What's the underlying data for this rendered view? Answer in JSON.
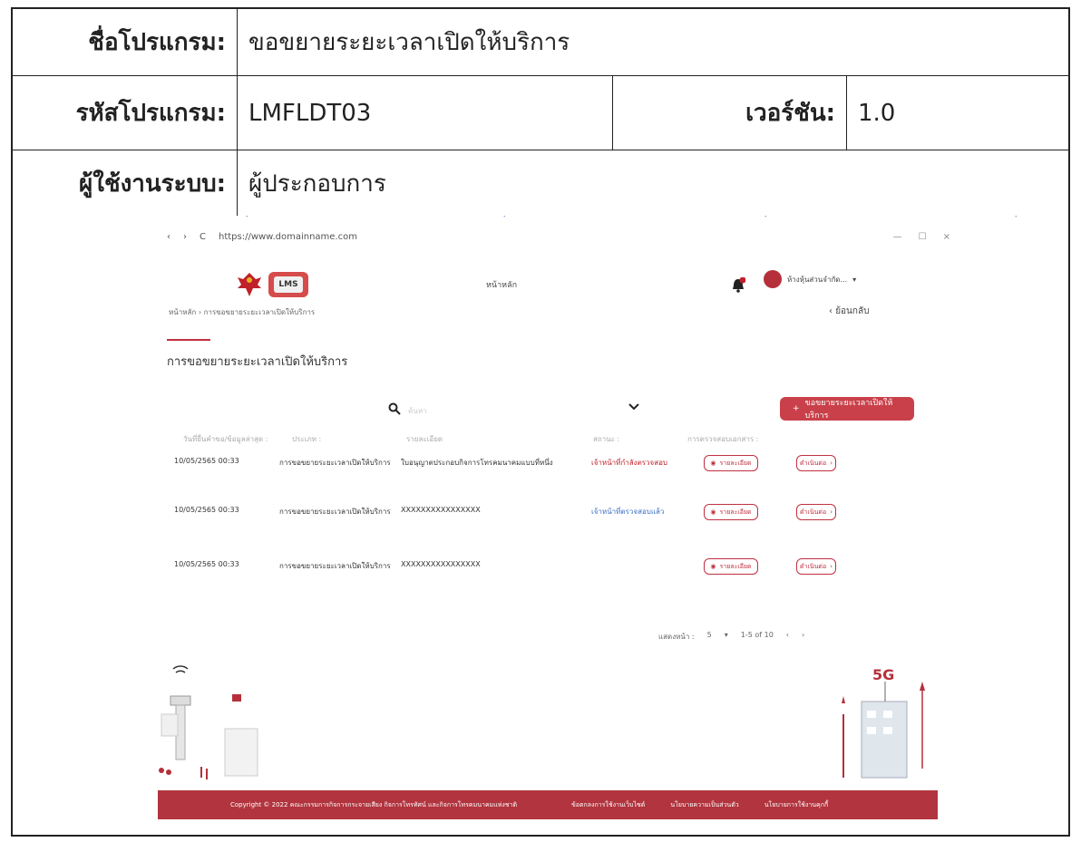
{
  "doc": {
    "program_name_label": "ชื่อโปรแกรม:",
    "program_name": "ขอขยายระยะเวลาเปิดให้บริการ",
    "program_code_label": "รหัสโปรแกรม:",
    "program_code": "LMFLDT03",
    "version_label": "เวอร์ชัน:",
    "version": "1.0",
    "user_label": "ผู้ใช้งานระบบ:",
    "user": "ผู้ประกอบการ"
  },
  "browser": {
    "back": "‹",
    "forward": "›",
    "reload": "C",
    "url": "https://www.domainname.com",
    "minimize": "—",
    "maximize": "☐",
    "close": "×"
  },
  "nav": {
    "home": "หน้าหลัก",
    "user_name": "ห้างหุ้นส่วนจำกัด...",
    "notification_count": "1"
  },
  "breadcrumb": {
    "home": "หน้าหลัก",
    "separator": "›",
    "current": "การขอขยายระยะเวลาเปิดให้บริการ"
  },
  "back_label": "ย้อนกลับ",
  "page_title": "การขอขยายระยะเวลาเปิดให้บริการ",
  "search": {
    "placeholder": "ค้นหา"
  },
  "add_button": "ขอขยายระยะเวลาเปิดให้บริการ",
  "table": {
    "headers": [
      "วันที่ยื่นคำขอ/ข้อมูลล่าสุด :",
      "ประเภท :",
      "รายละเอียด",
      "สถานะ :",
      "การตรวจสอบเอกสาร :"
    ],
    "rows": [
      {
        "date": "10/05/2565 00:33",
        "type": "การขอขยายระยะเวลาเปิดให้บริการ",
        "detail": "ใบอนุญาตประกอบกิจการโทรคมนาคมแบบที่หนึ่ง",
        "status": "เจ้าหน้าที่กำลังตรวจสอบ",
        "status_color": "#c0202a",
        "detail_btn": "รายละเอียด",
        "action_btn": "ดำเนินต่อ"
      },
      {
        "date": "10/05/2565 00:33",
        "type": "การขอขยายระยะเวลาเปิดให้บริการ",
        "detail": "XXXXXXXXXXXXXXXX",
        "status": "เจ้าหน้าที่ตรวจสอบแล้ว",
        "status_color": "#3a6fc6",
        "detail_btn": "รายละเอียด",
        "action_btn": "ดำเนินต่อ"
      },
      {
        "date": "10/05/2565 00:33",
        "type": "การขอขยายระยะเวลาเปิดให้บริการ",
        "detail": "XXXXXXXXXXXXXXXX",
        "status": "",
        "status_color": "#333333",
        "detail_btn": "รายละเอียด",
        "action_btn": "ดำเนินต่อ"
      }
    ]
  },
  "pager": {
    "rows_label": "แสดงหน้า :",
    "page_size": "5",
    "range": "1-5 of 10",
    "prev": "‹",
    "next": "›"
  },
  "footer": {
    "copyright": "Copyright © 2022 คณะกรรมการกิจการกระจายเสียง กิจการโทรทัศน์ และกิจการโทรคมนาคมแห่งชาติ",
    "links": [
      "ข้อตกลงการใช้งานเว็บไซต์",
      "นโยบายความเป็นส่วนตัว",
      "นโยบายการใช้งานคุกกี้"
    ]
  },
  "illustration": {
    "label_5g": "5G"
  },
  "colors": {
    "brand": "#c9404a",
    "footer": "#b1343e"
  }
}
